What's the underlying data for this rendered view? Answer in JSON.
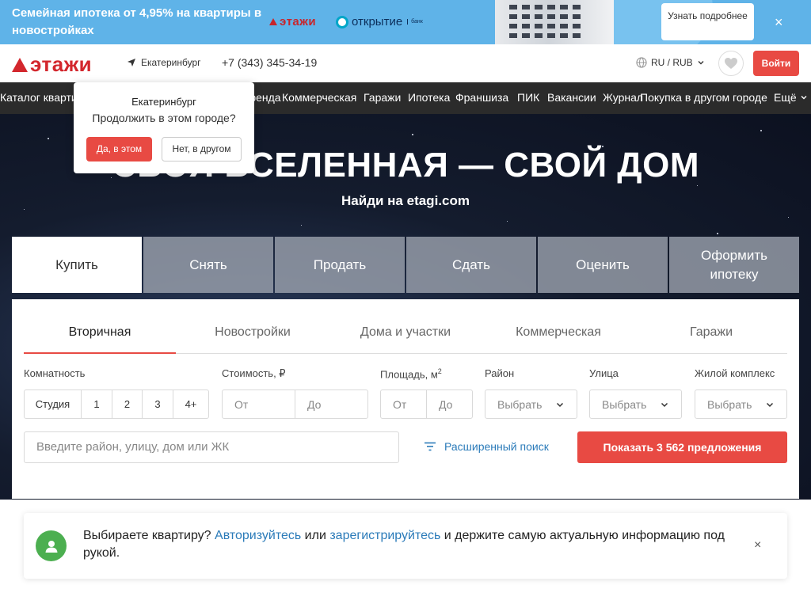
{
  "promo": {
    "text": "Семейная ипотека от 4,95% на квартиры в новостройках",
    "etagi_logo": "этажи",
    "bank_logo": "открытие",
    "bank_sub": "банк",
    "button_label": "Узнать подробнее",
    "close_icon": "×"
  },
  "header": {
    "logo": "этажи",
    "city": "Екатеринбург",
    "phone": "+7 (343) 345-34-19",
    "lang": "RU / RUB",
    "login": "Войти"
  },
  "nav": {
    "items": [
      "Каталог квартир",
      "Аренда",
      "Коммерческая",
      "Гаражи",
      "Ипотека",
      "Франшиза",
      "ПИК",
      "Вакансии",
      "Журнал",
      "Покупка в другом городе"
    ],
    "more": "Ещё"
  },
  "hero": {
    "title": "СВОЯ ВСЕЛЕННАЯ — СВОЙ ДОМ",
    "subtitle": "Найди на etagi.com"
  },
  "city_popup": {
    "city": "Екатеринбург",
    "question": "Продолжить в этом городе?",
    "yes": "Да, в этом",
    "no": "Нет, в другом"
  },
  "deal_tabs": [
    "Купить",
    "Снять",
    "Продать",
    "Сдать",
    "Оценить",
    "Оформить ипотеку"
  ],
  "category_tabs": [
    "Вторичная",
    "Новостройки",
    "Дома и участки",
    "Коммерческая",
    "Гаражи"
  ],
  "filters": {
    "rooms_label": "Комнатность",
    "rooms": [
      "Студия",
      "1",
      "2",
      "3",
      "4+"
    ],
    "price_label": "Стоимость, ₽",
    "price_from": "От",
    "price_to": "До",
    "area_label": "Площадь, м",
    "area_sup": "2",
    "area_from": "От",
    "area_to": "До",
    "district_label": "Район",
    "district_value": "Выбрать",
    "street_label": "Улица",
    "street_value": "Выбрать",
    "complex_label": "Жилой комплекс",
    "complex_value": "Выбрать"
  },
  "search": {
    "placeholder": "Введите район, улицу, дом или ЖК",
    "advanced": "Расширенный поиск",
    "show_button": "Показать 3 562 предложения"
  },
  "notice": {
    "text_before": "Выбираете квартиру? ",
    "login_link": "Авторизуйтесь",
    "text_mid": " или ",
    "register_link": "зарегистрируйтесь",
    "text_after": " и держите самую актуальную информацию под рукой."
  },
  "colors": {
    "accent": "#e84a43",
    "promo_bg": "#5fb3e8",
    "nav_bg": "#2b2b2b",
    "link": "#2b7bb9"
  }
}
